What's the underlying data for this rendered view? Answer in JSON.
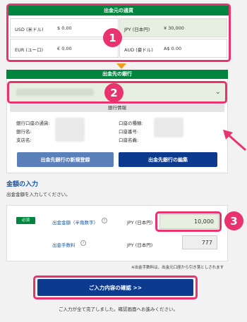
{
  "currency": {
    "title": "出金元の通貨",
    "items": [
      {
        "code": "USD (米ドル)",
        "value": "$ 0.00"
      },
      {
        "code": "JPY (日本円)",
        "value": "¥ 30,000"
      },
      {
        "code": "EUR (ユーロ)",
        "value": "€ 0.00"
      },
      {
        "code": "AUD (豪ドル)",
        "value": "A$ 0.00"
      }
    ]
  },
  "bank": {
    "title": "出金先の銀行",
    "info_title": "銀行情報",
    "labels_left": [
      "銀行口座の通貨:",
      "銀行名:",
      "支店名:"
    ],
    "labels_right": [
      "口座の種類:",
      "口座番号:",
      "口座名義:"
    ],
    "register_button": "出金先銀行の新規登録",
    "edit_button": "出金先銀行の編集"
  },
  "amount": {
    "heading": "金額の入力",
    "subtext": "出金金額を入力してください。",
    "required_badge": "必須",
    "amount_label": "出金金額（半角数字）",
    "amount_currency": "JPY (日本円)",
    "amount_value": "10,000",
    "fee_label": "出金手数料",
    "fee_currency": "JPY (日本円)",
    "fee_value": "777",
    "note": "※出金手数料は、出金元口座から引き落としされます"
  },
  "confirm": {
    "button": "ご入力内容の確認 >>",
    "footer": "ご入力が全て完了しました。確認画面へお進みください。"
  },
  "steps": {
    "one": "1",
    "two": "2",
    "three": "3"
  },
  "colors": {
    "accent": "#e8336f",
    "green": "#00853e",
    "navy": "#0b3a8f"
  }
}
